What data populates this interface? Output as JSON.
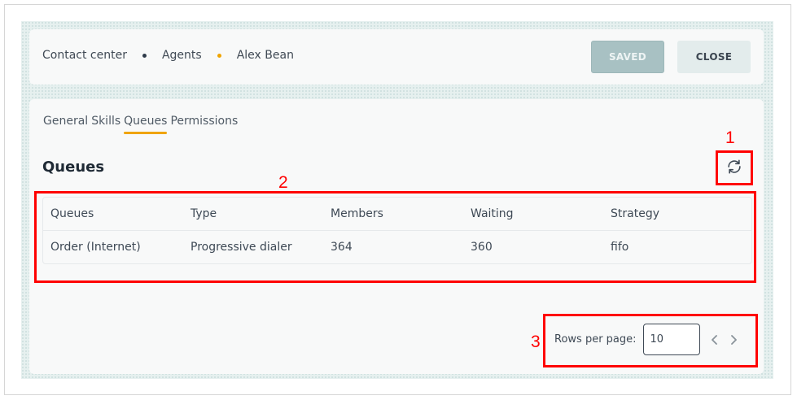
{
  "breadcrumb": {
    "items": [
      "Contact center",
      "Agents",
      "Alex Bean"
    ]
  },
  "header": {
    "saved_label": "SAVED",
    "close_label": "CLOSE"
  },
  "tabs": [
    {
      "label": "General",
      "active": false
    },
    {
      "label": "Skills",
      "active": false
    },
    {
      "label": "Queues",
      "active": true
    },
    {
      "label": "Permissions",
      "active": false
    }
  ],
  "section": {
    "title": "Queues"
  },
  "table": {
    "columns": [
      "Queues",
      "Type",
      "Members",
      "Waiting",
      "Strategy"
    ],
    "rows": [
      [
        "Order (Internet)",
        "Progressive dialer",
        "364",
        "360",
        "fifo"
      ]
    ]
  },
  "pagination": {
    "rows_per_page_label": "Rows per page:",
    "rows_per_page_value": "10"
  },
  "annotations": {
    "one": "1",
    "two": "2",
    "three": "3"
  },
  "colors": {
    "accent": "#f0a400",
    "annotation": "#ff0000",
    "saved_button": "#a8c1c3"
  },
  "icons": {
    "refresh": "refresh-icon",
    "prev": "chevron-left-icon",
    "next": "chevron-right-icon"
  }
}
